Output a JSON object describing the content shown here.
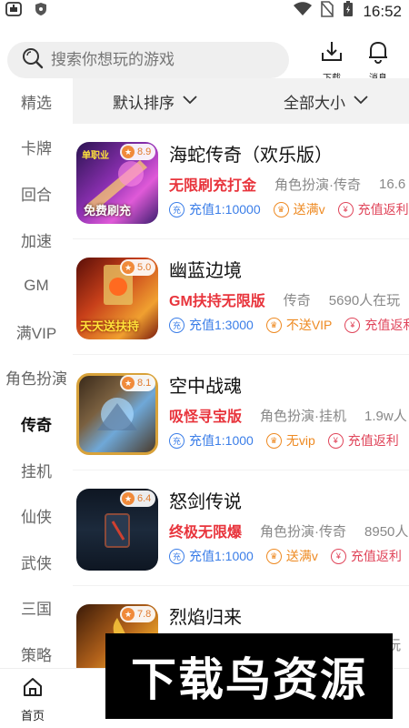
{
  "status_bar": {
    "time": "16:52"
  },
  "header": {
    "search_placeholder": "搜索你想玩的游戏",
    "download_label": "下载",
    "message_label": "消息"
  },
  "sidebar": {
    "items": [
      {
        "label": "精选"
      },
      {
        "label": "卡牌"
      },
      {
        "label": "回合"
      },
      {
        "label": "加速"
      },
      {
        "label": "GM"
      },
      {
        "label": "满VIP"
      },
      {
        "label": "角色扮演"
      },
      {
        "label": "传奇"
      },
      {
        "label": "挂机"
      },
      {
        "label": "仙侠"
      },
      {
        "label": "武侠"
      },
      {
        "label": "三国"
      },
      {
        "label": "策略"
      }
    ],
    "active": "传奇"
  },
  "filter": {
    "sort_label": "默认排序",
    "size_label": "全部大小"
  },
  "games": [
    {
      "name": "海蛇传奇（欢乐版）",
      "rating": "8.9",
      "promo": "无限刷充打金",
      "meta": "角色扮演·传奇",
      "extra": "16.6",
      "tag1": "充值1:10000",
      "tag2": "送满v",
      "tag3": "充值返利",
      "icon_text": "免费刷充",
      "icon_top": "单职业",
      "colors": {
        "a": "#3a1d6e",
        "b": "#d04bd6"
      }
    },
    {
      "name": "幽蓝边境",
      "rating": "5.0",
      "promo": "GM扶持无限版",
      "meta": "传奇",
      "extra": "5690人在玩",
      "tag1": "充值1:3000",
      "tag2": "不送VIP",
      "tag3": "充值返利",
      "icon_text": "天天送扶持",
      "icon_top": "",
      "colors": {
        "a": "#7a1a0e",
        "b": "#f0a030"
      }
    },
    {
      "name": "空中战魂",
      "rating": "8.1",
      "promo": "吸怪寻宝版",
      "meta": "角色扮演·挂机",
      "extra": "1.9w人",
      "tag1": "充值1:1000",
      "tag2": "无vip",
      "tag3": "充值返利",
      "icon_text": "",
      "icon_top": "",
      "colors": {
        "a": "#4a3a2a",
        "b": "#6fa8d8"
      }
    },
    {
      "name": "怒剑传说",
      "rating": "6.4",
      "promo": "终极无限爆",
      "meta": "角色扮演·传奇",
      "extra": "8950人",
      "tag1": "充值1:1000",
      "tag2": "送满v",
      "tag3": "充值返利",
      "icon_text": "",
      "icon_top": "",
      "colors": {
        "a": "#0e1622",
        "b": "#2a3a50"
      }
    },
    {
      "name": "烈焰归来",
      "rating": "7.8",
      "promo": "",
      "meta": "",
      "extra": "玩",
      "tag1": "",
      "tag2": "",
      "tag3": "",
      "icon_text": "",
      "icon_top": "",
      "colors": {
        "a": "#3a1a08",
        "b": "#e8a028"
      }
    }
  ],
  "bottom_nav": {
    "home_label": "首页"
  },
  "watermark": {
    "text": "下载鸟资源"
  }
}
